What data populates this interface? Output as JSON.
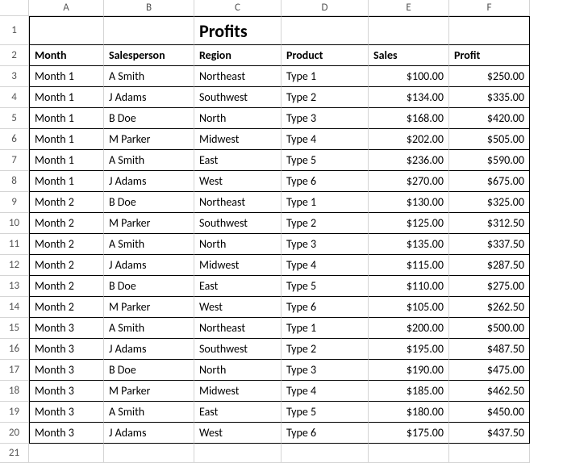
{
  "columns": [
    "A",
    "B",
    "C",
    "D",
    "E",
    "F"
  ],
  "rownums": [
    "1",
    "2",
    "3",
    "4",
    "5",
    "6",
    "7",
    "8",
    "9",
    "10",
    "11",
    "12",
    "13",
    "14",
    "15",
    "16",
    "17",
    "18",
    "19",
    "20",
    "21"
  ],
  "title": "Profits",
  "headers": {
    "month": "Month",
    "salesperson": "Salesperson",
    "region": "Region",
    "product": "Product",
    "sales": "Sales",
    "profit": "Profit"
  },
  "rows": [
    {
      "month": "Month 1",
      "sp": "A Smith",
      "region": "Northeast",
      "product": "Type 1",
      "sales": "$100.00",
      "profit": "$250.00"
    },
    {
      "month": "Month 1",
      "sp": "J Adams",
      "region": "Southwest",
      "product": "Type 2",
      "sales": "$134.00",
      "profit": "$335.00"
    },
    {
      "month": "Month 1",
      "sp": "B Doe",
      "region": "North",
      "product": "Type 3",
      "sales": "$168.00",
      "profit": "$420.00"
    },
    {
      "month": "Month 1",
      "sp": "M Parker",
      "region": "Midwest",
      "product": "Type 4",
      "sales": "$202.00",
      "profit": "$505.00"
    },
    {
      "month": "Month 1",
      "sp": "A Smith",
      "region": "East",
      "product": "Type 5",
      "sales": "$236.00",
      "profit": "$590.00"
    },
    {
      "month": "Month 1",
      "sp": "J Adams",
      "region": "West",
      "product": "Type 6",
      "sales": "$270.00",
      "profit": "$675.00"
    },
    {
      "month": "Month 2",
      "sp": "B Doe",
      "region": "Northeast",
      "product": "Type 1",
      "sales": "$130.00",
      "profit": "$325.00"
    },
    {
      "month": "Month 2",
      "sp": "M Parker",
      "region": "Southwest",
      "product": "Type 2",
      "sales": "$125.00",
      "profit": "$312.50"
    },
    {
      "month": "Month 2",
      "sp": "A Smith",
      "region": "North",
      "product": "Type 3",
      "sales": "$135.00",
      "profit": "$337.50"
    },
    {
      "month": "Month 2",
      "sp": " J Adams",
      "region": " Midwest",
      "product": " Type 4",
      "sales": "$115.00",
      "profit": "$287.50"
    },
    {
      "month": "Month 2",
      "sp": " B Doe",
      "region": " East",
      "product": " Type 5",
      "sales": "$110.00",
      "profit": "$275.00"
    },
    {
      "month": "Month 2",
      "sp": " M Parker",
      "region": " West",
      "product": " Type 6",
      "sales": "$105.00",
      "profit": "$262.50"
    },
    {
      "month": "Month 3",
      "sp": " A Smith",
      "region": " Northeast",
      "product": " Type 1",
      "sales": "$200.00",
      "profit": "$500.00"
    },
    {
      "month": "Month 3",
      "sp": " J Adams",
      "region": " Southwest",
      "product": " Type 2",
      "sales": "$195.00",
      "profit": "$487.50"
    },
    {
      "month": "Month 3",
      "sp": " B Doe",
      "region": " North",
      "product": " Type 3",
      "sales": "$190.00",
      "profit": "$475.00"
    },
    {
      "month": "Month 3",
      "sp": " M Parker",
      "region": " Midwest",
      "product": " Type 4",
      "sales": "$185.00",
      "profit": "$462.50"
    },
    {
      "month": "Month 3",
      "sp": " A Smith",
      "region": " East",
      "product": " Type 5",
      "sales": "$180.00",
      "profit": "$450.00"
    },
    {
      "month": "Month 3",
      "sp": " J Adams",
      "region": " West",
      "product": " Type 6",
      "sales": "$175.00",
      "profit": "$437.50"
    }
  ],
  "chart_data": {
    "type": "table",
    "title": "Profits",
    "columns": [
      "Month",
      "Salesperson",
      "Region",
      "Product",
      "Sales",
      "Profit"
    ],
    "data": [
      [
        "Month 1",
        "A Smith",
        "Northeast",
        "Type 1",
        100.0,
        250.0
      ],
      [
        "Month 1",
        "J Adams",
        "Southwest",
        "Type 2",
        134.0,
        335.0
      ],
      [
        "Month 1",
        "B Doe",
        "North",
        "Type 3",
        168.0,
        420.0
      ],
      [
        "Month 1",
        "M Parker",
        "Midwest",
        "Type 4",
        202.0,
        505.0
      ],
      [
        "Month 1",
        "A Smith",
        "East",
        "Type 5",
        236.0,
        590.0
      ],
      [
        "Month 1",
        "J Adams",
        "West",
        "Type 6",
        270.0,
        675.0
      ],
      [
        "Month 2",
        "B Doe",
        "Northeast",
        "Type 1",
        130.0,
        325.0
      ],
      [
        "Month 2",
        "M Parker",
        "Southwest",
        "Type 2",
        125.0,
        312.5
      ],
      [
        "Month 2",
        "A Smith",
        "North",
        "Type 3",
        135.0,
        337.5
      ],
      [
        "Month 2",
        "J Adams",
        "Midwest",
        "Type 4",
        115.0,
        287.5
      ],
      [
        "Month 2",
        "B Doe",
        "East",
        "Type 5",
        110.0,
        275.0
      ],
      [
        "Month 2",
        "M Parker",
        "West",
        "Type 6",
        105.0,
        262.5
      ],
      [
        "Month 3",
        "A Smith",
        "Northeast",
        "Type 1",
        200.0,
        500.0
      ],
      [
        "Month 3",
        "J Adams",
        "Southwest",
        "Type 2",
        195.0,
        487.5
      ],
      [
        "Month 3",
        "B Doe",
        "North",
        "Type 3",
        190.0,
        475.0
      ],
      [
        "Month 3",
        "M Parker",
        "Midwest",
        "Type 4",
        185.0,
        462.5
      ],
      [
        "Month 3",
        "A Smith",
        "East",
        "Type 5",
        180.0,
        450.0
      ],
      [
        "Month 3",
        "J Adams",
        "West",
        "Type 6",
        175.0,
        437.5
      ]
    ]
  }
}
